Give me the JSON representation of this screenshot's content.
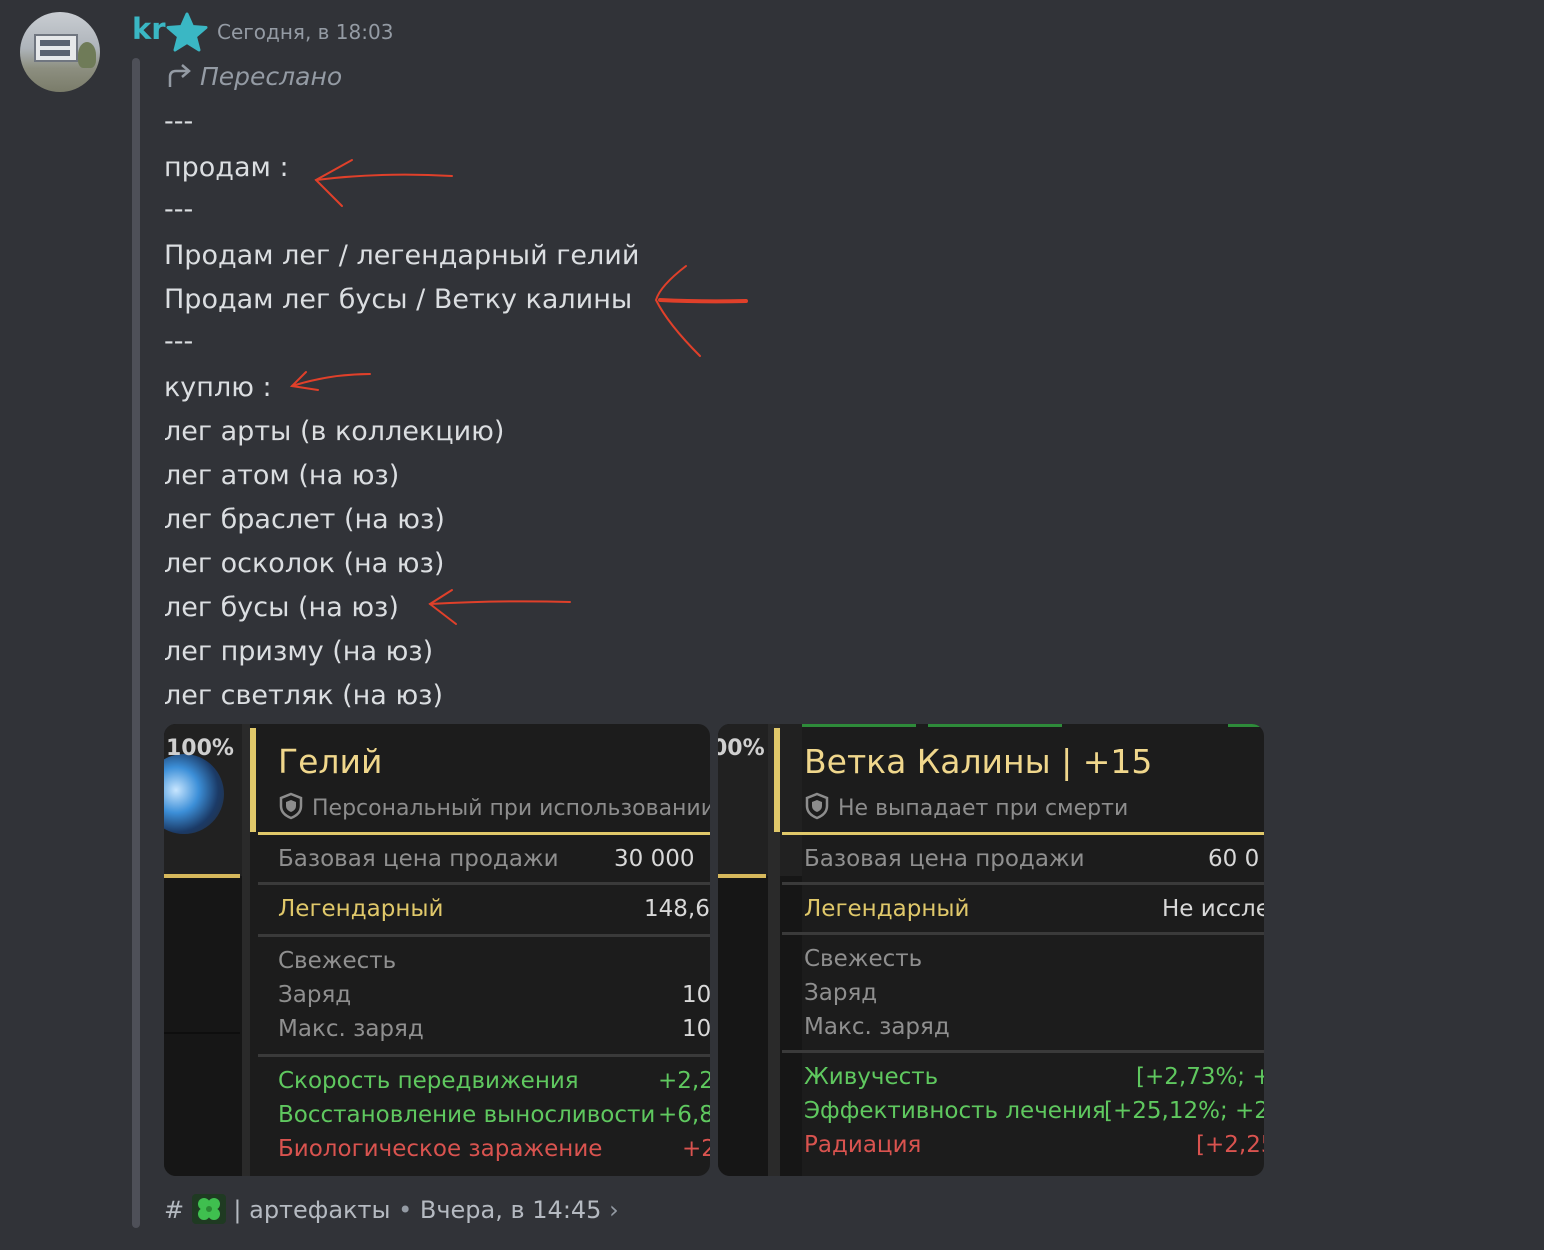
{
  "author": {
    "name": "kr",
    "timestamp": "Сегодня, в 18:03"
  },
  "forwarded_label": "Переслано",
  "message_lines": [
    "---",
    "продам :",
    "---",
    "Продам лег / легендарный гелий",
    "Продам лег бусы / Ветку калины",
    "---",
    "куплю :",
    "лег арты (в коллекцию)",
    "лег атом (на юз)",
    "лег браслет (на юз)",
    "лег осколок (на юз)",
    "лег бусы (на юз)",
    "лег призму (на юз)",
    "лег светляк (на юз)"
  ],
  "cards": [
    {
      "thumb_percent": "100%",
      "title": "Гелий",
      "subtitle": "Персональный при использовании",
      "price_label": "Базовая цена продажи",
      "price_value": "30 000",
      "rarity_label": "Легендарный",
      "rarity_value": "148,6",
      "freshness_label": "Свежесть",
      "charge_label": "Заряд",
      "charge_value": "10",
      "max_charge_label": "Макс. заряд",
      "max_charge_value": "10",
      "stats": [
        {
          "name": "Скорость передвижения",
          "value": "+2,2",
          "type": "green"
        },
        {
          "name": "Восстановление выносливости",
          "value": "+6,8",
          "type": "green"
        },
        {
          "name": "Биологическое заражение",
          "value": "+2",
          "type": "red"
        }
      ]
    },
    {
      "thumb_percent": "00%",
      "title": "Ветка Калины | +15",
      "subtitle": "Не выпадает при смерти",
      "price_label": "Базовая цена продажи",
      "price_value": "60 0",
      "rarity_label": "Легендарный",
      "rarity_value": "Не иссле",
      "freshness_label": "Свежесть",
      "charge_label": "Заряд",
      "charge_value": "",
      "max_charge_label": "Макс. заряд",
      "max_charge_value": "",
      "stats": [
        {
          "name": "Живучесть",
          "value": "[+2,73%; +",
          "type": "green"
        },
        {
          "name": "Эффективность лечения",
          "value": "[+25,12%; +2",
          "type": "green"
        },
        {
          "name": "Радиация",
          "value": "[+2,25",
          "type": "red"
        }
      ]
    }
  ],
  "footer": {
    "hash": "#",
    "channel": "| артефакты",
    "separator": "•",
    "time": "Вчера, в 14:45",
    "chevron": "›"
  },
  "icons": {
    "star": "star-icon",
    "forward": "forward-arrow-icon",
    "shield": "shield-icon",
    "clover": "clover-icon"
  },
  "colors": {
    "username": "#3ab7c4",
    "star": "#3ab7c4",
    "annotation": "#e0402a"
  }
}
